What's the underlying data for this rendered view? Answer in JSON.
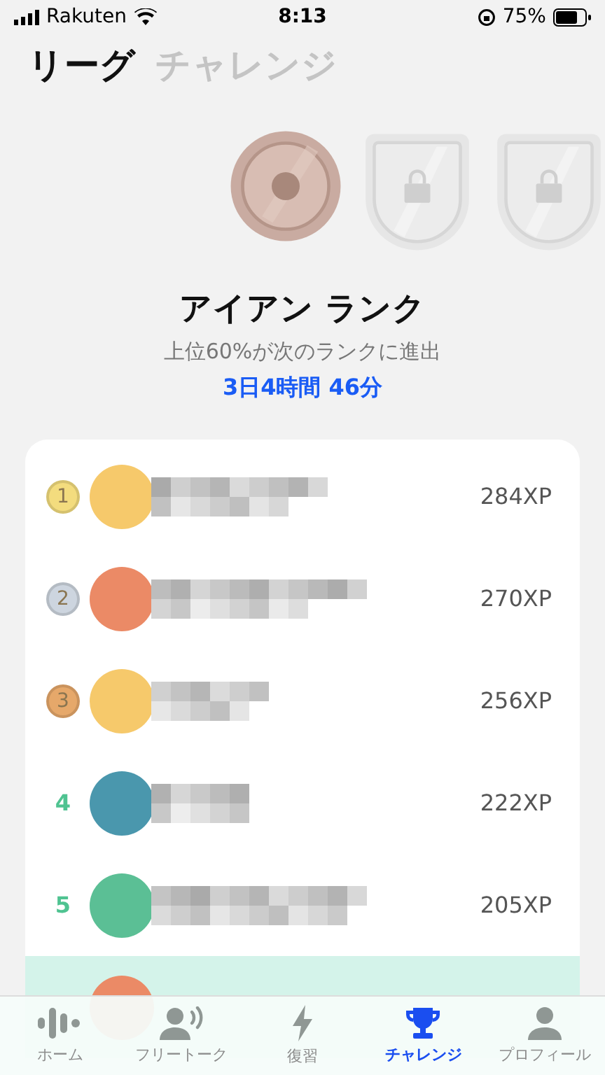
{
  "status_bar": {
    "carrier": "Rakuten",
    "time": "8:13",
    "battery": "75%"
  },
  "header_tabs": [
    {
      "label": "リーグ",
      "selected": true
    },
    {
      "label": "チャレンジ",
      "selected": false
    }
  ],
  "badges": [
    {
      "kind": "current"
    },
    {
      "kind": "locked"
    },
    {
      "kind": "locked"
    }
  ],
  "rank": {
    "title": "アイアン ランク",
    "subtitle": "上位60%が次のランクに進出",
    "countdown": "3日4時間 46分"
  },
  "leaderboard": [
    {
      "kind": "gold",
      "rank": "1",
      "color": "#f6c96b",
      "xp": "284XP",
      "highlighted": false
    },
    {
      "kind": "silver",
      "rank": "2",
      "color": "#eb8a66",
      "xp": "270XP",
      "highlighted": false
    },
    {
      "kind": "bronze",
      "rank": "3",
      "color": "#f6c96b",
      "xp": "256XP",
      "highlighted": false
    },
    {
      "kind": "number",
      "rank": "4",
      "color": "#4a97ad",
      "xp": "222XP",
      "highlighted": false
    },
    {
      "kind": "number",
      "rank": "5",
      "color": "#5bbf95",
      "xp": "205XP",
      "highlighted": false
    },
    {
      "kind": "partial",
      "color": "#eb8a66",
      "highlighted": true
    }
  ],
  "bottom_nav": [
    {
      "kind": "home",
      "label": "ホーム",
      "selected": false
    },
    {
      "kind": "talk",
      "label": "フリートーク",
      "selected": false
    },
    {
      "kind": "review",
      "label": "復習",
      "selected": false
    },
    {
      "kind": "challenge",
      "label": "チャレンジ",
      "selected": true
    },
    {
      "kind": "profile",
      "label": "プロフィール",
      "selected": false
    }
  ]
}
